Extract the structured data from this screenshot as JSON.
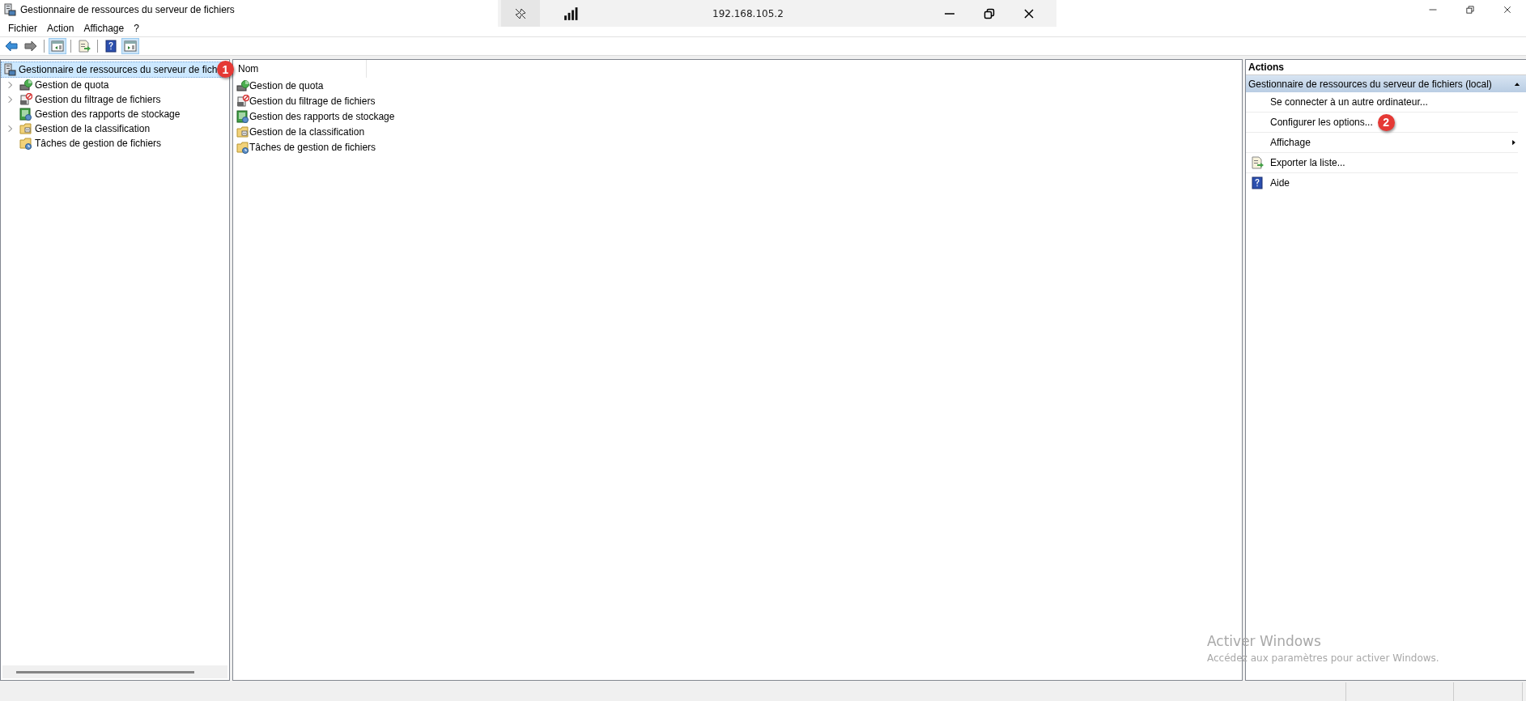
{
  "window": {
    "title": "Gestionnaire de ressources du serveur de fichiers"
  },
  "remote_bar": {
    "address": "192.168.105.2"
  },
  "menu": [
    "Fichier",
    "Action",
    "Affichage",
    "?"
  ],
  "toolbar": [
    {
      "kind": "back",
      "selected": false
    },
    {
      "kind": "forward",
      "selected": false
    },
    {
      "kind": "tree",
      "selected": true
    },
    {
      "kind": "export",
      "selected": false
    },
    {
      "kind": "help",
      "selected": false
    },
    {
      "kind": "actions",
      "selected": true
    }
  ],
  "tree": [
    {
      "label": "Gestionnaire de ressources du serveur de fich",
      "kind": "server",
      "selected": true,
      "badge": "1",
      "children": [
        {
          "label": "Gestion de quota",
          "kind": "quota",
          "selected": false,
          "collapsed": true
        },
        {
          "label": "Gestion du filtrage de fichiers",
          "kind": "screening",
          "selected": false,
          "collapsed": true
        },
        {
          "label": "Gestion des rapports de stockage",
          "kind": "reports",
          "selected": false,
          "collapsed": false
        },
        {
          "label": "Gestion de la classification",
          "kind": "classification",
          "selected": false,
          "collapsed": true
        },
        {
          "label": "Tâches de gestion de fichiers",
          "kind": "tasks",
          "selected": false,
          "collapsed": false
        }
      ]
    }
  ],
  "list": {
    "columns": [
      "Nom"
    ],
    "rows": [
      {
        "label": "Gestion de quota",
        "kind": "quota"
      },
      {
        "label": "Gestion du filtrage de fichiers",
        "kind": "screening"
      },
      {
        "label": "Gestion des rapports de stockage",
        "kind": "reports"
      },
      {
        "label": "Gestion de la classification",
        "kind": "classification"
      },
      {
        "label": "Tâches de gestion de fichiers",
        "kind": "tasks"
      }
    ]
  },
  "actions": {
    "title": "Actions",
    "section": {
      "label": "Gestionnaire de ressources du serveur de fichiers (local)",
      "expanded": true
    },
    "items": [
      {
        "label": "Se connecter à un autre ordinateur...",
        "kind": "plain"
      },
      {
        "label": "Configurer les options...",
        "kind": "plain",
        "badge": "2"
      },
      {
        "label": "Affichage",
        "kind": "submenu"
      },
      {
        "label": "Exporter la liste...",
        "kind": "export"
      },
      {
        "label": "Aide",
        "kind": "help"
      }
    ]
  },
  "activation": {
    "title": "Activer Windows",
    "text": "Accédez aux paramètres pour activer Windows."
  }
}
